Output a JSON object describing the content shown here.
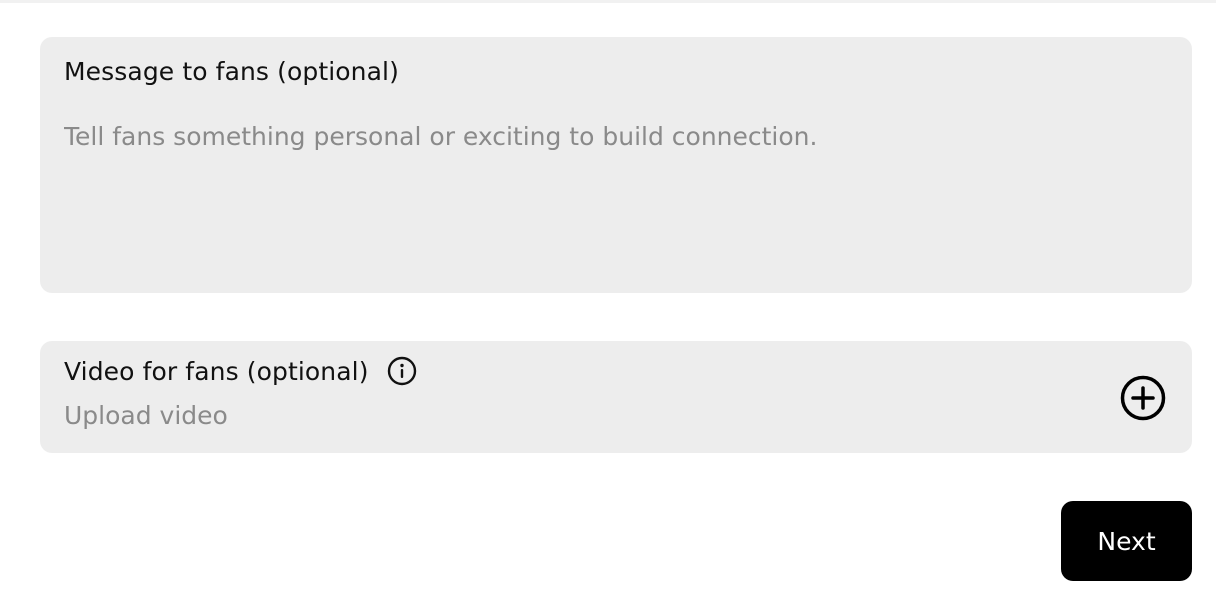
{
  "message_section": {
    "label": "Message to fans (optional)",
    "value": "",
    "placeholder": "Tell fans something personal or exciting to build connection."
  },
  "video_section": {
    "label": "Video for fans (optional)",
    "upload_hint": "Upload video",
    "info_icon": "info-icon",
    "add_icon": "plus-circle-icon"
  },
  "actions": {
    "next_label": "Next"
  },
  "colors": {
    "card_background": "#ededed",
    "primary_text": "#111111",
    "placeholder_text": "#8a8a8a",
    "button_background": "#000000",
    "button_text": "#ffffff"
  }
}
